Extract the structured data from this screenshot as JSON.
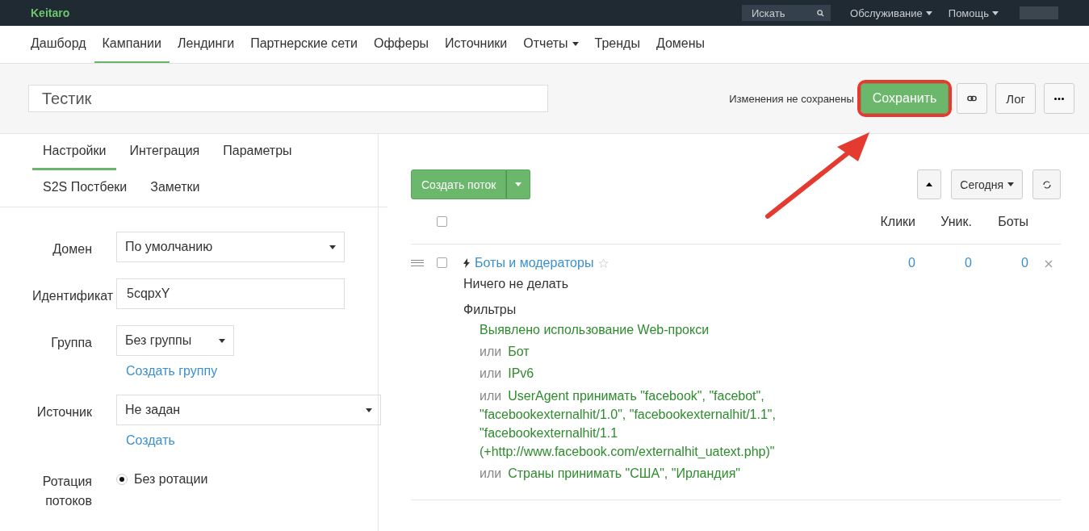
{
  "topbar": {
    "logo": "Keitaro",
    "search": {
      "placeholder": "Искать"
    },
    "menus": [
      "Обслуживание",
      "Помощь"
    ]
  },
  "nav": [
    {
      "label": "Дашборд",
      "selected": false,
      "dropdown": false
    },
    {
      "label": "Кампании",
      "selected": true,
      "dropdown": false
    },
    {
      "label": "Лендинги",
      "selected": false,
      "dropdown": false
    },
    {
      "label": "Партнерские сети",
      "selected": false,
      "dropdown": false
    },
    {
      "label": "Офферы",
      "selected": false,
      "dropdown": false
    },
    {
      "label": "Источники",
      "selected": false,
      "dropdown": false
    },
    {
      "label": "Отчеты",
      "selected": false,
      "dropdown": true
    },
    {
      "label": "Тренды",
      "selected": false,
      "dropdown": false
    },
    {
      "label": "Домены",
      "selected": false,
      "dropdown": false
    }
  ],
  "header": {
    "name": "Тестик",
    "status": "Изменения не сохранены",
    "save": {
      "label": "Сохранить",
      "highlighted": true
    },
    "log": "Лог"
  },
  "settings_tabs": [
    {
      "label": "Настройки",
      "selected": true
    },
    {
      "label": "Интеграция",
      "selected": false
    },
    {
      "label": "Параметры",
      "selected": false
    },
    {
      "label": "S2S Постбеки",
      "selected": false
    },
    {
      "label": "Заметки",
      "selected": false
    }
  ],
  "form": [
    {
      "kind": "select",
      "label": "Домен",
      "value": "По умолчанию"
    },
    {
      "kind": "input",
      "label": "Идентификат",
      "value": "5cqpxY"
    },
    {
      "kind": "select",
      "label": "Группа",
      "value": "Без группы",
      "link": "Создать группу"
    },
    {
      "kind": "select",
      "label": "Источник",
      "value": "Не задан",
      "link": "Создать"
    },
    {
      "kind": "radio",
      "label": "Ротация потоков",
      "options": [
        {
          "label": "Без ротации",
          "selected": true
        }
      ]
    }
  ],
  "streams": {
    "create": "Создать поток",
    "period": "Сегодня",
    "select_all": false,
    "columns": [
      "Клики",
      "Уник.",
      "Боты"
    ],
    "rows": [
      {
        "name": "Боты и модераторы",
        "starred": false,
        "checked": false,
        "action": "Ничего не делать",
        "filters_title": "Фильтры",
        "filters": [
          {
            "text": "Выявлено использование Web-прокси"
          },
          {
            "prefix": "или",
            "text": "Бот"
          },
          {
            "prefix": "или",
            "text": "IPv6"
          },
          {
            "prefix": "или",
            "text": "UserAgent принимать \"facebook\", \"facebot\", \"facebookexternalhit/1.0\", \"facebookexternalhit/1.1\", \"facebookexternalhit/1.1 (+http://www.facebook.com/externalhit_uatext.php)\""
          },
          {
            "prefix": "или",
            "text": "Страны принимать \"США\", \"Ирландия\""
          }
        ],
        "values": [
          "0",
          "0",
          "0"
        ]
      }
    ]
  }
}
